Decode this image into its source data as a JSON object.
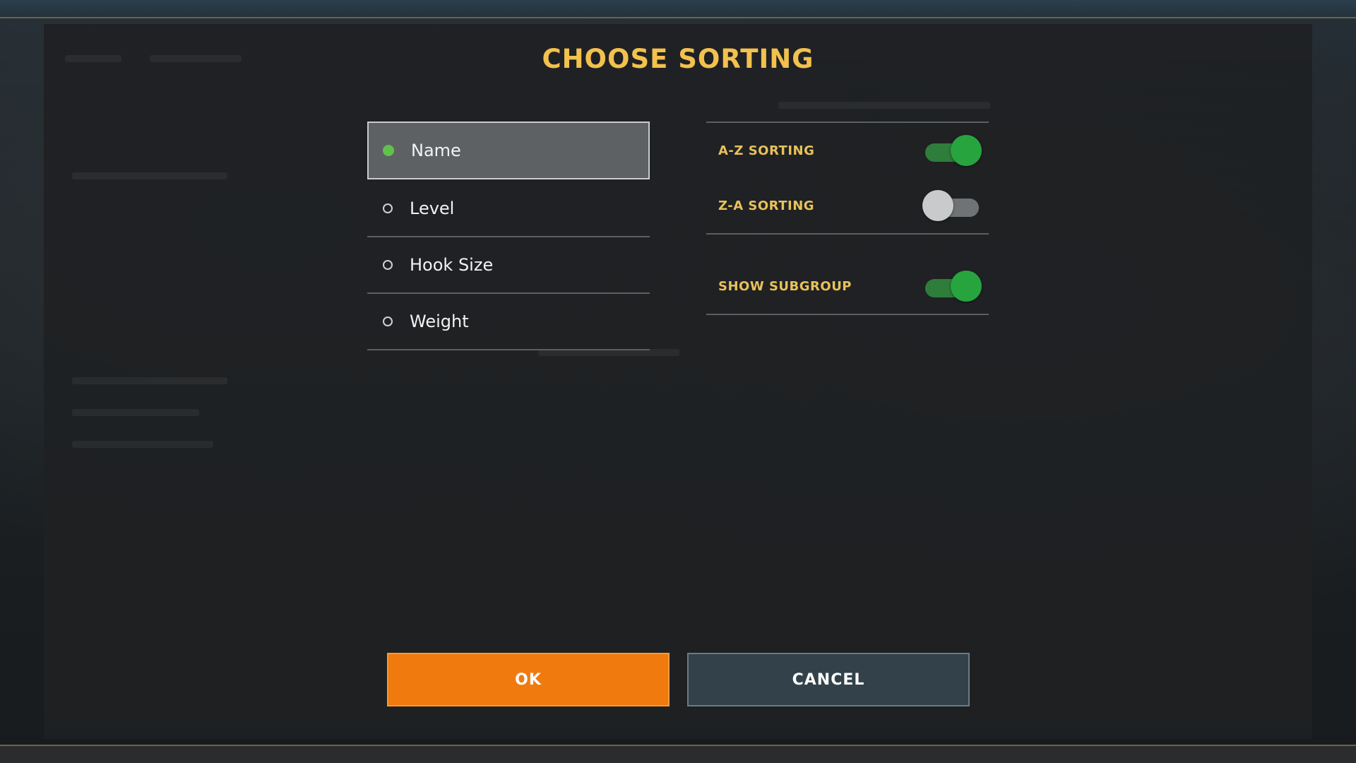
{
  "dialog": {
    "title": "CHOOSE SORTING"
  },
  "sort_options": [
    {
      "label": "Name",
      "selected": true
    },
    {
      "label": "Level",
      "selected": false
    },
    {
      "label": "Hook Size",
      "selected": false
    },
    {
      "label": "Weight",
      "selected": false
    }
  ],
  "settings": {
    "az_sorting": {
      "label": "A-Z SORTING",
      "on": true
    },
    "za_sorting": {
      "label": "Z-A SORTING",
      "on": false
    },
    "show_subgroup": {
      "label": "SHOW SUBGROUP",
      "on": true
    }
  },
  "buttons": {
    "ok_label": "OK",
    "cancel_label": "CANCEL"
  },
  "colors": {
    "title": "#f2c14e",
    "accent_orange": "#f07a0e",
    "toggle_on": "#28a43f",
    "selected_dot": "#5fc24a"
  }
}
